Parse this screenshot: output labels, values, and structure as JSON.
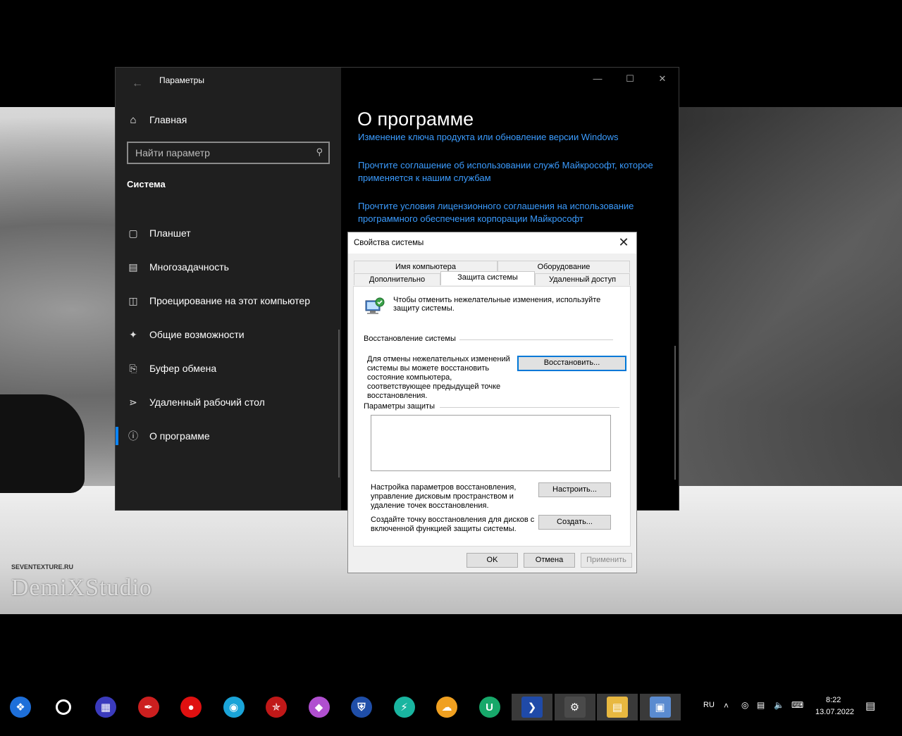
{
  "settings": {
    "app_title": "Параметры",
    "home": "Главная",
    "search_placeholder": "Найти параметр",
    "section": "Система",
    "nav": [
      {
        "label": "Планшет",
        "icon": "tablet-icon"
      },
      {
        "label": "Многозадачность",
        "icon": "multitasking-icon"
      },
      {
        "label": "Проецирование на этот компьютер",
        "icon": "projecting-icon"
      },
      {
        "label": "Общие возможности",
        "icon": "shared-experiences-icon"
      },
      {
        "label": "Буфер обмена",
        "icon": "clipboard-icon"
      },
      {
        "label": "Удаленный рабочий стол",
        "icon": "remote-desktop-icon"
      },
      {
        "label": "О программе",
        "icon": "info-icon",
        "active": true
      }
    ],
    "page_title": "О программе",
    "links": [
      "Изменение ключа продукта или обновление версии Windows",
      "Прочтите соглашение об использовании служб Майкрософт, которое применяется к нашим службам",
      "Прочтите условия лицензионного соглашения на использование программного обеспечения корпорации Майкрософт"
    ]
  },
  "dialog": {
    "title": "Свойства системы",
    "tabs_row1": [
      "Имя компьютера",
      "Оборудование"
    ],
    "tabs_row2": [
      "Дополнительно",
      "Защита системы",
      "Удаленный доступ"
    ],
    "active_tab": "Защита системы",
    "intro": "Чтобы отменить нежелательные изменения, используйте защиту системы.",
    "restore_group": "Восстановление системы",
    "restore_text": "Для отмены нежелательных изменений системы вы можете восстановить состояние компьютера, соответствующее предыдущей точке восстановления.",
    "restore_button": "Восстановить...",
    "protection_group": "Параметры защиты",
    "configure_text": "Настройка параметров восстановления, управление дисковым пространством и удаление точек восстановления.",
    "configure_button": "Настроить...",
    "create_text": "Создайте точку восстановления для дисков с включенной функцией защиты системы.",
    "create_button": "Создать...",
    "ok": "OK",
    "cancel": "Отмена",
    "apply": "Применить"
  },
  "wallpaper": {
    "watermark": "DemiXStudio",
    "small_text": "SEVENTEXTURE.RU"
  },
  "taskbar": {
    "apps": [
      {
        "name": "start-orb-icon",
        "color": "#1e6fd9"
      },
      {
        "name": "cortana-icon",
        "color": "#000000"
      },
      {
        "name": "app-store-icon",
        "color": "#3b3bbd"
      },
      {
        "name": "paint-icon",
        "color": "#cc1f1f"
      },
      {
        "name": "recorder-icon",
        "color": "#e01010"
      },
      {
        "name": "edge-icon",
        "color": "#1aa4d8"
      },
      {
        "name": "antivirus-icon",
        "color": "#c01818"
      },
      {
        "name": "gem-app-icon",
        "color": "#b04fd0"
      },
      {
        "name": "shield-app-icon",
        "color": "#1f4ea8"
      },
      {
        "name": "vpn-icon",
        "color": "#19b5a0"
      },
      {
        "name": "weather-icon",
        "color": "#f0a020"
      },
      {
        "name": "u-app-icon",
        "color": "#17a86a"
      },
      {
        "name": "powershell-icon",
        "color": "#1f4aa8"
      },
      {
        "name": "settings-gear-icon",
        "color": "#4a4a4a"
      },
      {
        "name": "file-explorer-icon",
        "color": "#e8b840"
      },
      {
        "name": "system-properties-icon",
        "color": "#5a8bd0"
      }
    ],
    "language": "RU",
    "time": "8:22",
    "date": "13.07.2022"
  }
}
